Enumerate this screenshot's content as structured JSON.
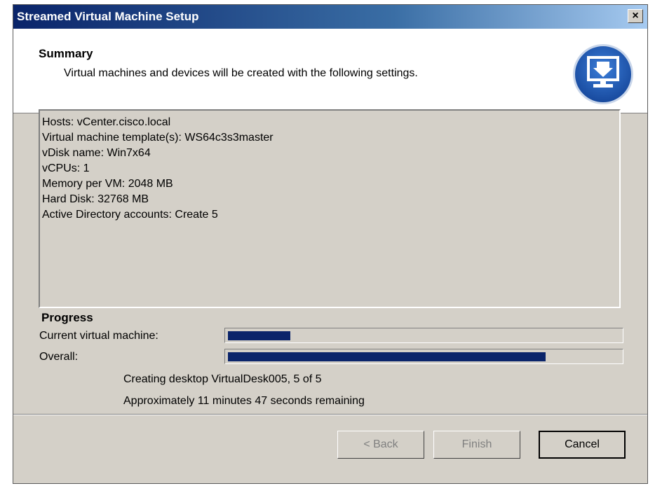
{
  "window": {
    "title": "Streamed Virtual Machine Setup",
    "close_glyph": "×"
  },
  "header": {
    "title": "Summary",
    "subtitle": "Virtual machines and devices will be created with the following settings.",
    "icon": "download-monitor-icon"
  },
  "summary": {
    "lines": [
      "Hosts: vCenter.cisco.local",
      "Virtual machine template(s): WS64c3s3master",
      "vDisk name: Win7x64",
      "vCPUs: 1",
      "Memory per VM: 2048 MB",
      "Hard Disk: 32768 MB",
      "Active Directory accounts: Create 5"
    ]
  },
  "progress": {
    "title": "Progress",
    "current_label": "Current virtual machine:",
    "current_fraction": 0.16,
    "overall_label": "Overall:",
    "overall_fraction": 0.81,
    "status_line": "Creating desktop VirtualDesk005, 5 of 5",
    "time_remaining": "Approximately 11 minutes 47 seconds remaining"
  },
  "buttons": {
    "back": "< Back",
    "finish": "Finish",
    "cancel": "Cancel"
  },
  "colors": {
    "title_bar": "#0a246a",
    "progress_fill": "#0a246a",
    "dialog_bg": "#d4d0c8"
  }
}
